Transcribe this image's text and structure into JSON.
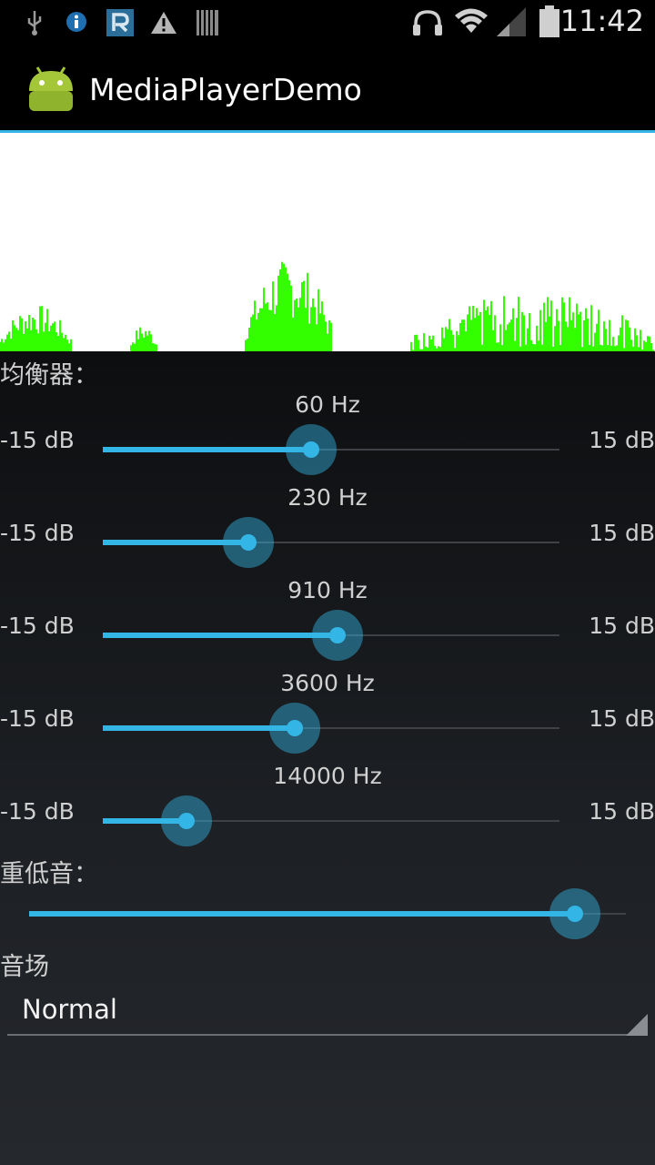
{
  "status_bar": {
    "time": "11:42",
    "icons": [
      "usb-icon",
      "info-icon",
      "r-app-icon",
      "warning-icon",
      "barcode-icon",
      "headset-icon",
      "wifi-icon",
      "signal-icon",
      "battery-icon"
    ]
  },
  "action_bar": {
    "title": "MediaPlayerDemo",
    "app_icon": "android-icon"
  },
  "equalizer": {
    "label": "均衡器：",
    "bands": [
      {
        "freq": "60 Hz",
        "min": "-15 dB",
        "max": "15 dB",
        "level": 0.457
      },
      {
        "freq": "230 Hz",
        "min": "-15 dB",
        "max": "15 dB",
        "level": 0.319
      },
      {
        "freq": "910 Hz",
        "min": "-15 dB",
        "max": "15 dB",
        "level": 0.513
      },
      {
        "freq": "3600 Hz",
        "min": "-15 dB",
        "max": "15 dB",
        "level": 0.421
      },
      {
        "freq": "14000 Hz",
        "min": "-15 dB",
        "max": "15 dB",
        "level": 0.184
      }
    ]
  },
  "bass_boost": {
    "label": "重低音：",
    "level": 0.914
  },
  "reverb": {
    "label": "音场",
    "selected": "Normal"
  },
  "colors": {
    "accent": "#33b5e5",
    "visualizer_wave": "#33ff00",
    "visualizer_background": "#ffffff"
  }
}
